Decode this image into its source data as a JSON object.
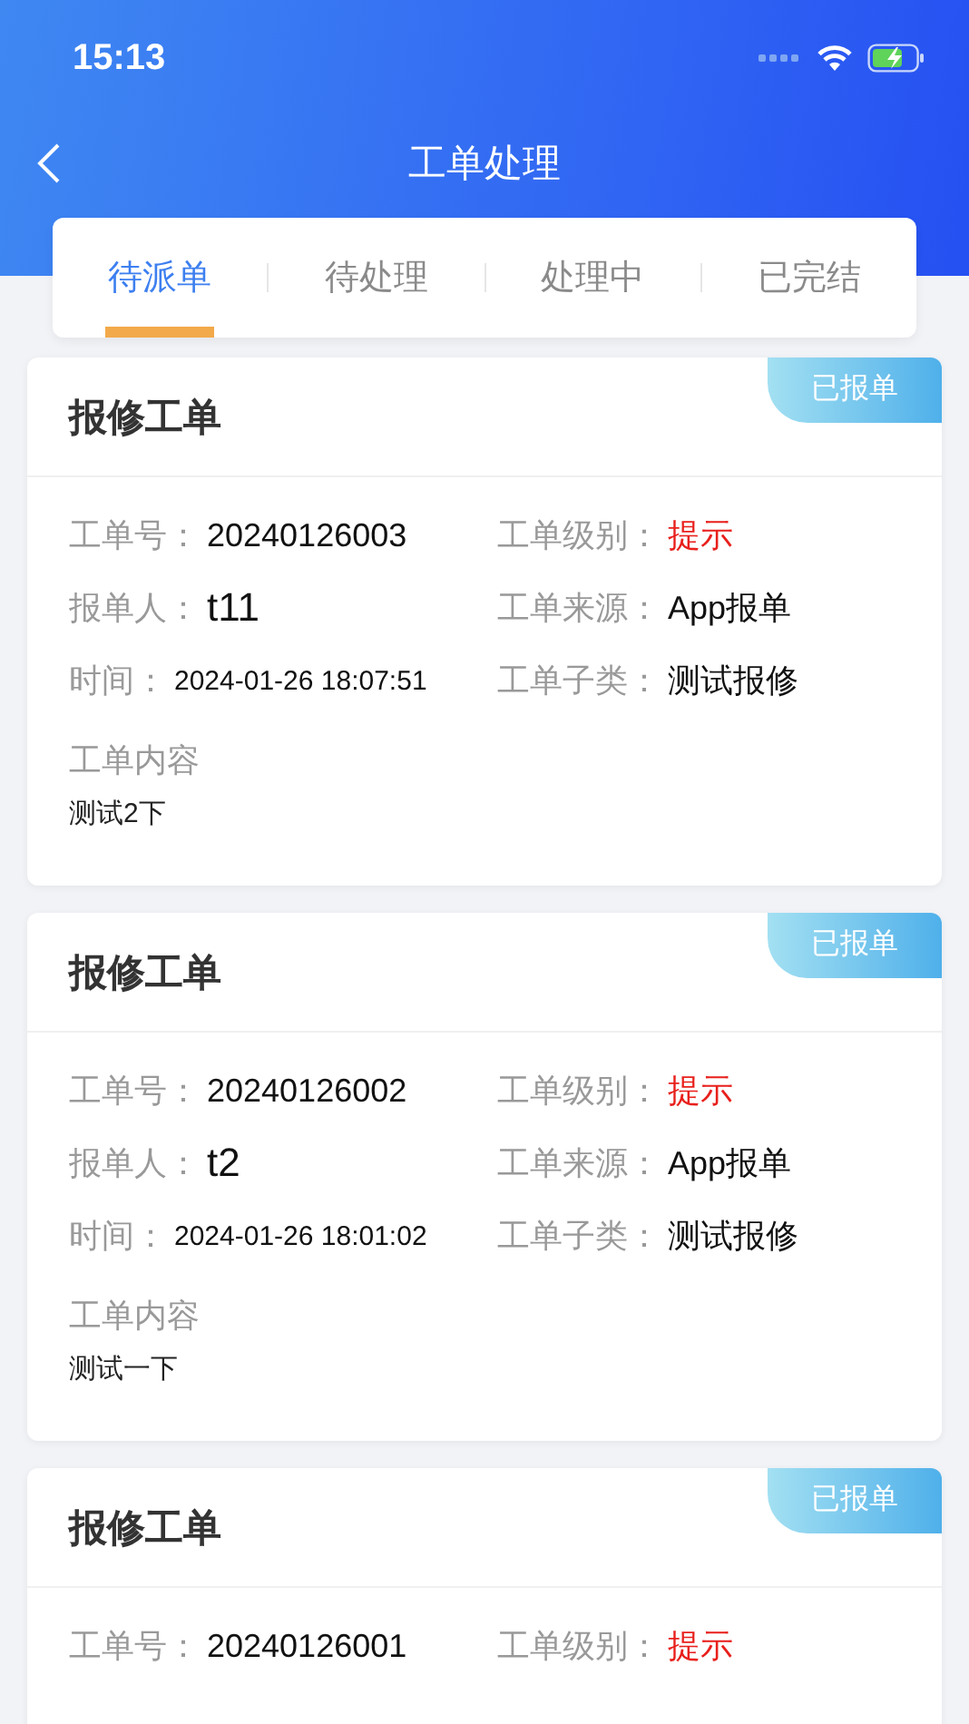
{
  "status_bar": {
    "time": "15:13"
  },
  "nav": {
    "title": "工单处理"
  },
  "tabs": [
    {
      "label": "待派单",
      "selected": true
    },
    {
      "label": "待处理",
      "selected": false
    },
    {
      "label": "处理中",
      "selected": false
    },
    {
      "label": "已完结",
      "selected": false
    }
  ],
  "orders": [
    {
      "title": "报修工单",
      "badge": "已报单",
      "fields": [
        {
          "label": "工单号：",
          "value": "20240126003",
          "kind": "text"
        },
        {
          "label": "工单级别：",
          "value": "提示",
          "kind": "alert"
        },
        {
          "label": "报单人：",
          "value": "t11",
          "kind": "large"
        },
        {
          "label": "工单来源：",
          "value": "App报单",
          "kind": "text"
        },
        {
          "label": "时间：",
          "value": "2024-01-26 18:07:51",
          "kind": "small"
        },
        {
          "label": "工单子类：",
          "value": "测试报修",
          "kind": "text"
        }
      ],
      "content_label": "工单内容",
      "content": "测试2下"
    },
    {
      "title": "报修工单",
      "badge": "已报单",
      "fields": [
        {
          "label": "工单号：",
          "value": "20240126002",
          "kind": "text"
        },
        {
          "label": "工单级别：",
          "value": "提示",
          "kind": "alert"
        },
        {
          "label": "报单人：",
          "value": "t2",
          "kind": "large"
        },
        {
          "label": "工单来源：",
          "value": "App报单",
          "kind": "text"
        },
        {
          "label": "时间：",
          "value": "2024-01-26 18:01:02",
          "kind": "small"
        },
        {
          "label": "工单子类：",
          "value": "测试报修",
          "kind": "text"
        }
      ],
      "content_label": "工单内容",
      "content": "测试一下"
    },
    {
      "title": "报修工单",
      "badge": "已报单",
      "fields": [
        {
          "label": "工单号：",
          "value": "20240126001",
          "kind": "text"
        },
        {
          "label": "工单级别：",
          "value": "提示",
          "kind": "alert"
        }
      ]
    }
  ]
}
